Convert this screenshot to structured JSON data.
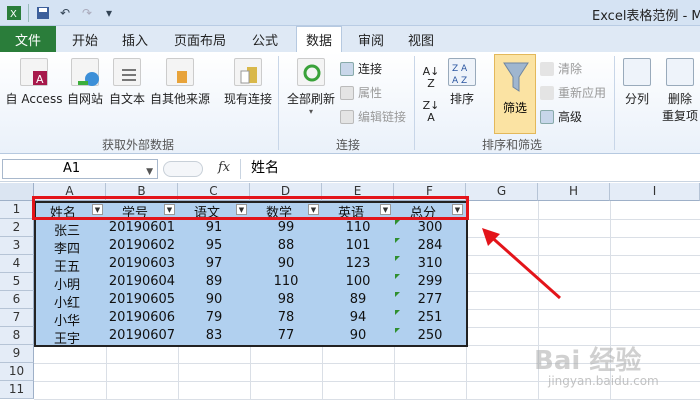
{
  "window": {
    "title": "Excel表格范例 - Mi"
  },
  "tabs": [
    "文件",
    "开始",
    "插入",
    "页面布局",
    "公式",
    "数据",
    "审阅",
    "视图"
  ],
  "ribbon": {
    "external_data": {
      "access": "自 Access",
      "web": "自网站",
      "text": "自文本",
      "other": "自其他来源",
      "existing": "现有连接",
      "group_label": "获取外部数据"
    },
    "connections": {
      "refresh_all": "全部刷新",
      "connections": "连接",
      "properties": "属性",
      "edit_links": "编辑链接",
      "group_label": "连接"
    },
    "sort_filter": {
      "sort": "排序",
      "filter": "筛选",
      "clear": "清除",
      "reapply": "重新应用",
      "advanced": "高级",
      "group_label": "排序和筛选"
    },
    "data_tools": {
      "text_to_columns": "分列",
      "remove_duplicates_line1": "删除",
      "remove_duplicates_line2": "重复项"
    }
  },
  "formula_bar": {
    "name_box": "A1",
    "fx": "fx",
    "content": "姓名"
  },
  "sheet": {
    "columns": [
      "A",
      "B",
      "C",
      "D",
      "E",
      "F",
      "G",
      "H",
      "I"
    ],
    "rows": [
      "1",
      "2",
      "3",
      "4",
      "5",
      "6",
      "7",
      "8",
      "9",
      "10",
      "11"
    ],
    "headers": [
      "姓名",
      "学号",
      "语文",
      "数学",
      "英语",
      "总分"
    ],
    "data": [
      [
        "张三",
        "20190601",
        "91",
        "99",
        "110",
        "300"
      ],
      [
        "李四",
        "20190602",
        "95",
        "88",
        "101",
        "284"
      ],
      [
        "王五",
        "20190603",
        "97",
        "90",
        "123",
        "310"
      ],
      [
        "小明",
        "20190604",
        "89",
        "110",
        "100",
        "299"
      ],
      [
        "小红",
        "20190605",
        "90",
        "98",
        "89",
        "277"
      ],
      [
        "小华",
        "20190606",
        "79",
        "78",
        "94",
        "251"
      ],
      [
        "王宇",
        "20190607",
        "83",
        "77",
        "90",
        "250"
      ]
    ]
  },
  "watermark": {
    "logo": "Bai 经验",
    "url": "jingyan.baidu.com"
  },
  "colors": {
    "file_tab": "#2a7d3a",
    "selection": "#b1d0ef",
    "highlight_box": "#e3141a",
    "arrow": "#e3141a"
  }
}
